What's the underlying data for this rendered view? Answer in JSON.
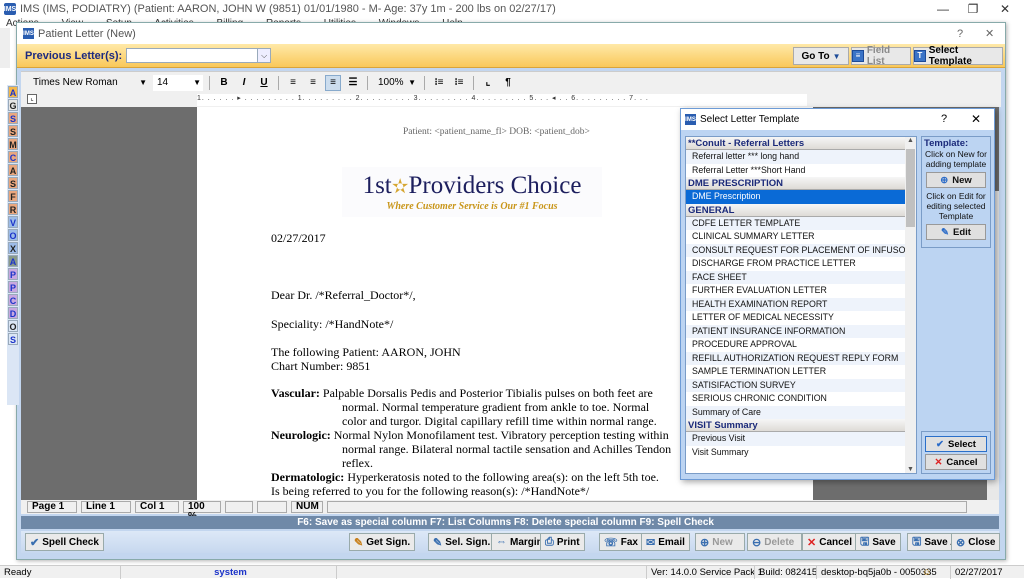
{
  "app": {
    "title": "IMS (IMS, PODIATRY)    (Patient: AARON, JOHN W (9851) 01/01/1980 - M- Age: 37y 1m - 200 lbs on 02/27/17)",
    "logo": "IMS",
    "menu": [
      "Actions",
      "View",
      "Setup",
      "Activities",
      "Billing",
      "Reports",
      "Utilities",
      "Windows",
      "Help"
    ],
    "window_controls": {
      "minimize": "—",
      "restore": "❐",
      "close": "✕"
    }
  },
  "dialog": {
    "title": "Patient Letter (New)",
    "help": "?",
    "close": "✕",
    "previous_letters_label": "Previous Letter(s):",
    "previous_letters_value": "",
    "goto_label": "Go To",
    "field_list_label": "Field List",
    "select_template_label": "Select Template"
  },
  "format": {
    "font": "Times New Roman",
    "size": "14",
    "bold": "B",
    "italic": "I",
    "underline": "U",
    "zoom": "100%",
    "pilcrow": "¶"
  },
  "ruler": {
    "marks": [
      "1",
      "1",
      "2",
      "3",
      "4",
      "5",
      "6",
      "7"
    ]
  },
  "side_strip": [
    "A",
    "G",
    "S",
    "S",
    "M",
    "C",
    "A",
    "S",
    "F",
    "R",
    "V",
    "O",
    "X",
    "A",
    "P",
    "P",
    "C",
    "D",
    "O",
    "S"
  ],
  "document": {
    "header": "Patient: <patient_name_fl>   DOB: <patient_dob>",
    "logo_main_1": "1st",
    "logo_main_2": "Providers Choice",
    "logo_tagline": "Where Customer Service is Our #1 Focus",
    "date": "02/27/2017",
    "salutation": "Dear Dr. /*Referral_Doctor*/,",
    "speciality": "Speciality: /*HandNote*/",
    "patient_line": "The following Patient: AARON, JOHN",
    "chart_line": "Chart Number: 9851",
    "vascular_label": "Vascular:",
    "vascular_1": "Palpable Dorsalis Pedis and Posterior Tibialis pulses on both feet are",
    "vascular_2": "normal. Normal temperature gradient from ankle to toe. Normal",
    "vascular_3": "color and turgor. Digital capillary refill time within normal range.",
    "neuro_label": "Neurologic:",
    "neuro_1": "Normal Nylon Monofilament test. Vibratory perception testing within",
    "neuro_2": "normal range. Bilateral normal tactile sensation and Achilles Tendon",
    "neuro_3": "reflex.",
    "derm_label": "Dermatologic:",
    "derm_1": " Hyperkeratosis noted to the following area(s): on the left 5th toe.",
    "referral_line": "Is being referred to you for the following reason(s): /*HandNote*/"
  },
  "status": {
    "page": "Page  1",
    "line": "Line  1",
    "col": "Col  1",
    "zoom": "100 %",
    "num": "NUM"
  },
  "fkeys": "F6: Save as special column   F7: List Columns   F8: Delete special column   F9:  Spell Check",
  "buttons": {
    "spell_check": "Spell Check",
    "get_sign": "Get Sign.",
    "sel_sign": "Sel. Sign.",
    "margin": "Margin",
    "print": "Print",
    "fax": "Fax",
    "email": "Email",
    "new": "New",
    "delete": "Delete",
    "cancel": "Cancel",
    "save": "Save",
    "save_as": "Save As",
    "close": "Close"
  },
  "template_dialog": {
    "title": "Select Letter Template",
    "help": "?",
    "close": "✕",
    "groups": [
      {
        "name": "**Conult - Referral Letters",
        "items": [
          "Referral letter *** long hand",
          "Referral Letter ***Short Hand"
        ]
      },
      {
        "name": "DME PRESCRIPTION",
        "items": [
          "DME Prescription"
        ]
      },
      {
        "name": "GENERAL",
        "items": [
          "CDFE LETTER TEMPLATE",
          "CLINICAL SUMMARY LETTER",
          "CONSULT REQUEST FOR PLACEMENT OF INFUSOPOR",
          "DISCHARGE FROM PRACTICE LETTER",
          "FACE SHEET",
          "FURTHER EVALUATION LETTER",
          "HEALTH EXAMINATION REPORT",
          "LETTER OF MEDICAL NECESSITY",
          "PATIENT INSURANCE INFORMATION",
          "PROCEDURE APPROVAL",
          "REFILL AUTHORIZATION REQUEST REPLY FORM",
          "SAMPLE TERMINATION LETTER",
          "SATISIFACTION SURVEY",
          "SERIOUS CHRONIC CONDITION",
          "Summary of Care"
        ]
      },
      {
        "name": "VISIT Summary",
        "items": [
          "Previous Visit",
          "Visit Summary"
        ]
      }
    ],
    "selected": "DME Prescription",
    "side_header": "Template:",
    "new_hint": "Click on New for adding template",
    "new_label": "New",
    "edit_hint": "Click on Edit for editing selected Template",
    "edit_label": "Edit",
    "select_label": "Select",
    "cancel_label": "Cancel"
  },
  "taskbar": {
    "ready": "Ready",
    "user": "system",
    "version": "Ver: 14.0.0 Service Pack 1",
    "build": "Build: 082415",
    "machine": "desktop-bq5ja0b - 0050335",
    "date": "02/27/2017"
  },
  "colors": {
    "accent": "#0a6ad6",
    "orange_bar": "#f9c85a",
    "fkey_bar": "#6f89a8",
    "group_text": "#1b2a7a"
  }
}
